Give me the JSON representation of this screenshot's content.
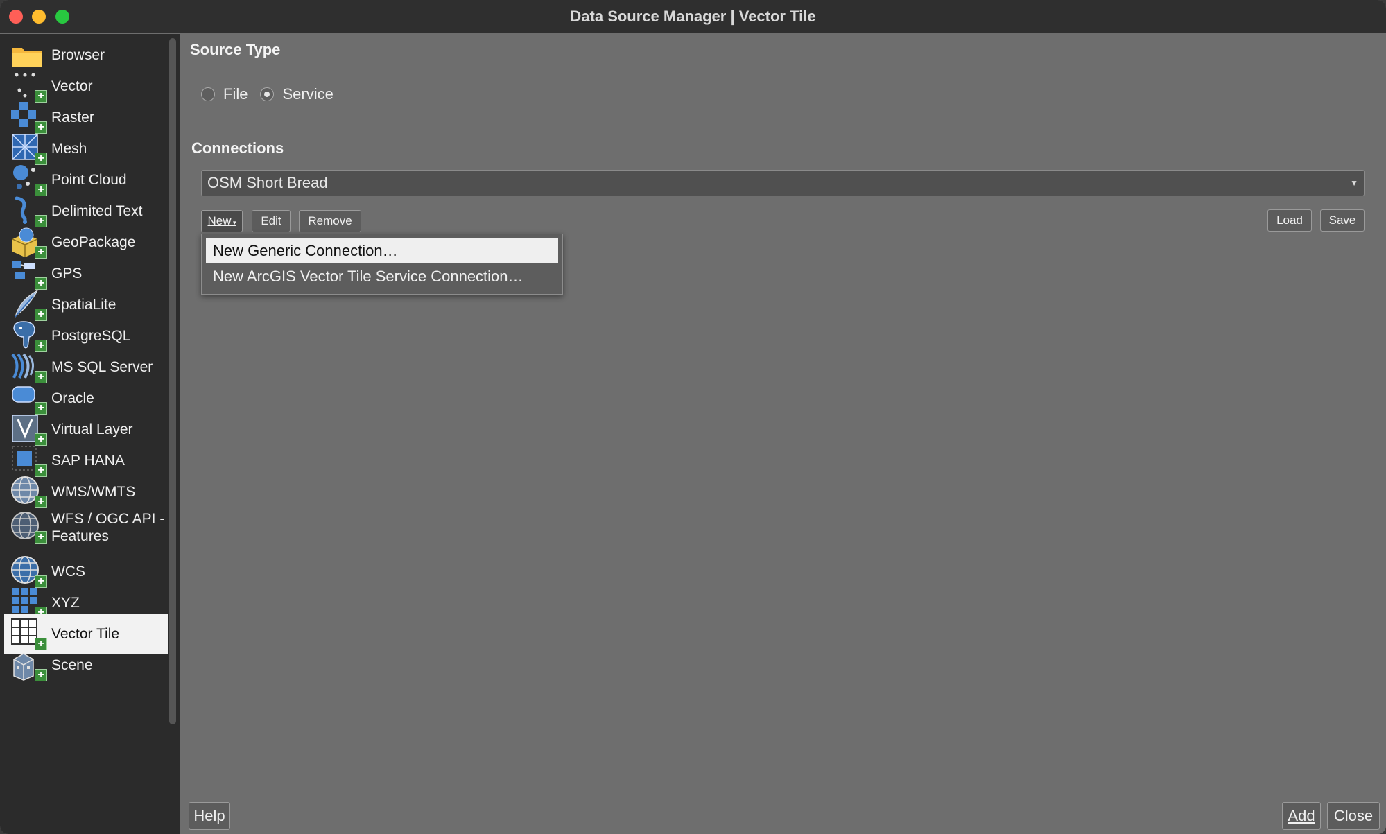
{
  "window": {
    "title": "Data Source Manager | Vector Tile"
  },
  "sidebar": {
    "items": [
      {
        "label": "Browser",
        "icon": "folder-icon"
      },
      {
        "label": "Vector",
        "icon": "vector-points-icon"
      },
      {
        "label": "Raster",
        "icon": "raster-icon"
      },
      {
        "label": "Mesh",
        "icon": "mesh-icon"
      },
      {
        "label": "Point Cloud",
        "icon": "point-cloud-icon"
      },
      {
        "label": "Delimited Text",
        "icon": "delimited-text-icon"
      },
      {
        "label": "GeoPackage",
        "icon": "geopackage-icon"
      },
      {
        "label": "GPS",
        "icon": "gps-icon"
      },
      {
        "label": "SpatiaLite",
        "icon": "spatialite-icon"
      },
      {
        "label": "PostgreSQL",
        "icon": "postgresql-icon"
      },
      {
        "label": "MS SQL Server",
        "icon": "mssql-icon"
      },
      {
        "label": "Oracle",
        "icon": "oracle-icon"
      },
      {
        "label": "Virtual Layer",
        "icon": "virtual-layer-icon"
      },
      {
        "label": "SAP HANA",
        "icon": "sap-hana-icon"
      },
      {
        "label": "WMS/WMTS",
        "icon": "wms-globe-icon"
      },
      {
        "label": "WFS / OGC API - Features",
        "icon": "wfs-globe-icon"
      },
      {
        "label": "WCS",
        "icon": "wcs-globe-icon"
      },
      {
        "label": "XYZ",
        "icon": "xyz-grid-icon"
      },
      {
        "label": "Vector Tile",
        "icon": "vector-tile-icon",
        "selected": true
      },
      {
        "label": "Scene",
        "icon": "scene-icon"
      }
    ]
  },
  "source_type": {
    "heading": "Source Type",
    "file_label": "File",
    "service_label": "Service",
    "selected": "Service"
  },
  "connections": {
    "heading": "Connections",
    "selected": "OSM Short Bread",
    "new_label": "New",
    "edit_label": "Edit",
    "remove_label": "Remove",
    "load_label": "Load",
    "save_label": "Save"
  },
  "new_menu": {
    "items": [
      "New Generic Connection…",
      "New ArcGIS Vector Tile Service Connection…"
    ]
  },
  "footer": {
    "help_label": "Help",
    "add_label": "Add",
    "close_label": "Close"
  },
  "colors": {
    "accent_green": "#3b8f3b",
    "selected_bg": "#f2f2f2",
    "panel_bg": "#6e6e6e",
    "sidebar_bg": "#2b2b2b"
  }
}
